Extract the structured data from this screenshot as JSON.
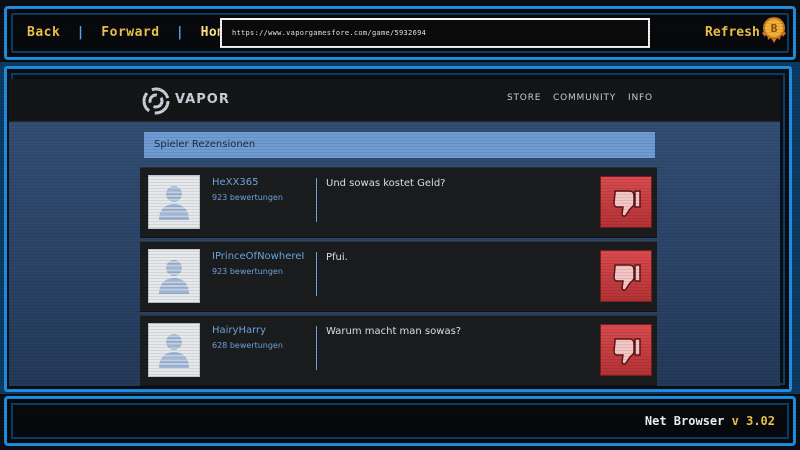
{
  "browser": {
    "nav": {
      "back": "Back",
      "forward": "Forward",
      "home": "Home",
      "separator": "|"
    },
    "url": "https://www.vaporgamesfore.com/game/5932694",
    "refresh": "Refresh",
    "coin_letter": "B",
    "footer": {
      "name": "Net Browser",
      "v_label": "v",
      "version": "3.02"
    },
    "colors": {
      "frame": "#1e8fe0",
      "accent_text": "#f0c34a"
    }
  },
  "site": {
    "brand": "VAPOR",
    "menu": [
      "STORE",
      "COMMUNITY",
      "INFO"
    ]
  },
  "reviews": {
    "title": "Spieler Rezensionen",
    "items": [
      {
        "username": "HeXX365",
        "count": "923 bewertungen",
        "text": "Und sowas kostet Geld?",
        "rating": "thumbs-down"
      },
      {
        "username": "IPrinceOfNowhereI",
        "count": "923 bewertungen",
        "text": "Pfui.",
        "rating": "thumbs-down"
      },
      {
        "username": "HairyHarry",
        "count": "628 bewertungen",
        "text": "Warum macht man sowas?",
        "rating": "thumbs-down"
      }
    ]
  }
}
